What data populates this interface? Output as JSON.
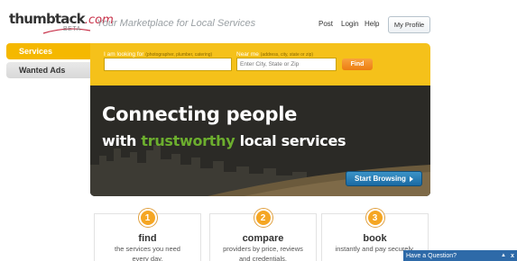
{
  "header": {
    "logo_text": "thumbtack",
    "logo_suffix": ".com",
    "logo_beta": "BETA",
    "tagline": "Your Marketplace for Local Services",
    "nav": {
      "post": "Post",
      "login": "Login",
      "help": "Help"
    },
    "profile_button": "My Profile"
  },
  "tabs": {
    "services": "Services",
    "wanted_ads": "Wanted Ads"
  },
  "search": {
    "what_label": "I am looking for",
    "what_hint": "(photographer, plumber, catering)",
    "what_value": "",
    "where_label": "Near me",
    "where_hint": "(address, city, state or zip)",
    "where_placeholder": "Enter City, State or Zip",
    "find_button": "Find"
  },
  "banner": {
    "line1": "Connecting people",
    "line2_pre": "with ",
    "line2_highlight": "trustworthy",
    "line2_post": " local services",
    "browse_button": "Start Browsing"
  },
  "steps": [
    {
      "number": "1",
      "title": "find",
      "desc_line1": "the services you need",
      "desc_line2": "every day."
    },
    {
      "number": "2",
      "title": "compare",
      "desc_line1": "providers by price, reviews",
      "desc_line2": "and credentials."
    },
    {
      "number": "3",
      "title": "book",
      "desc_line1": "instantly and pay securely.",
      "desc_line2": ""
    }
  ],
  "question_bar": {
    "title": "Have a Question?",
    "minimize": "▲",
    "close": "x"
  },
  "colors": {
    "brand_yellow": "#f5c11a",
    "accent_green": "#6cae2e",
    "browse_blue": "#1a6aa3",
    "step_orange": "#f5a623"
  }
}
